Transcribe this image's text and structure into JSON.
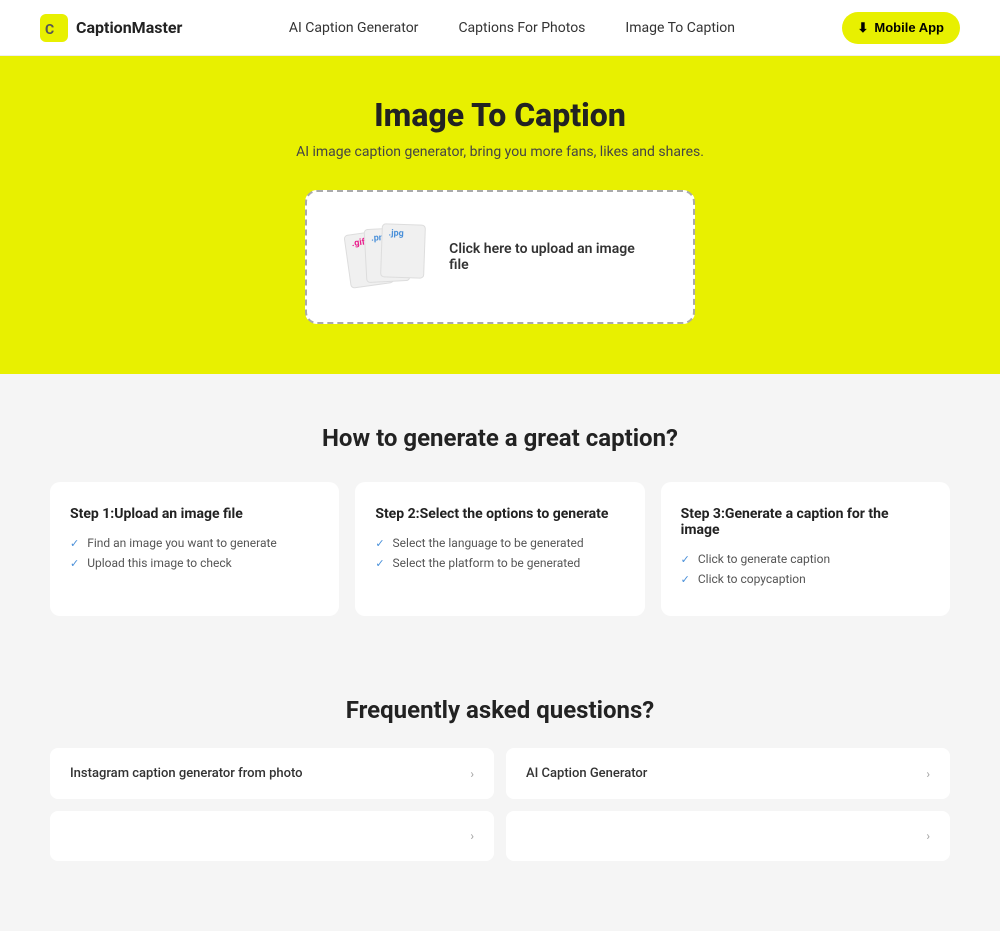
{
  "header": {
    "logo_text": "CaptionMaster",
    "nav_items": [
      {
        "label": "AI Caption Generator",
        "id": "ai-caption"
      },
      {
        "label": "Captions For Photos",
        "id": "captions-photos"
      },
      {
        "label": "Image To Caption",
        "id": "image-caption"
      }
    ],
    "mobile_app_btn": "Mobile App"
  },
  "hero": {
    "title": "Image To Caption",
    "subtitle": "AI image caption generator, bring you more fans, likes and shares.",
    "upload_text": "Click here to upload an image file",
    "file_labels": [
      ".gif",
      ".pn",
      ".jpg"
    ]
  },
  "how_section": {
    "title": "How to generate a great caption?",
    "steps": [
      {
        "title": "Step 1:Upload an image file",
        "items": [
          "Find an image you want to generate",
          "Upload this image to check"
        ]
      },
      {
        "title": "Step 2:Select the options to generate",
        "items": [
          "Select the language to be generated",
          "Select the platform to be generated"
        ]
      },
      {
        "title": "Step 3:Generate a caption for the image",
        "items": [
          "Click to generate caption",
          "Click to copycaption"
        ]
      }
    ]
  },
  "faq_section": {
    "title": "Frequently asked questions?",
    "items": [
      {
        "label": "Instagram caption generator from photo"
      },
      {
        "label": "AI Caption Generator"
      },
      {
        "label": ""
      },
      {
        "label": ""
      }
    ]
  }
}
